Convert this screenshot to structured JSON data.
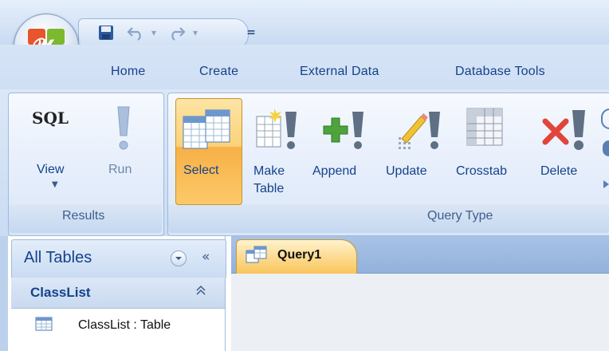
{
  "quick_access": {
    "save": "save-icon",
    "undo": "undo-icon",
    "redo": "redo-icon",
    "customize": "customize-dropdown-icon"
  },
  "tabs": [
    {
      "label": "Home"
    },
    {
      "label": "Create"
    },
    {
      "label": "External Data"
    },
    {
      "label": "Database Tools"
    }
  ],
  "ribbon": {
    "results": {
      "group_label": "Results",
      "sql_text": "SQL",
      "view_label": "View",
      "run_label": "Run"
    },
    "query_type": {
      "group_label": "Query Type",
      "select_label": "Select",
      "make_table_line1": "Make",
      "make_table_line2": "Table",
      "append_label": "Append",
      "update_label": "Update",
      "crosstab_label": "Crosstab",
      "delete_label": "Delete"
    }
  },
  "nav_pane": {
    "title": "All Tables",
    "collapse_glyph": "«",
    "group_title": "ClassList",
    "group_chevron": "⌃",
    "item_label": "ClassList : Table"
  },
  "document": {
    "tab_label": "Query1"
  },
  "colors": {
    "ribbon_text": "#15428b",
    "select_highlight": "#f8b047",
    "doc_tab": "#fcd98c"
  }
}
